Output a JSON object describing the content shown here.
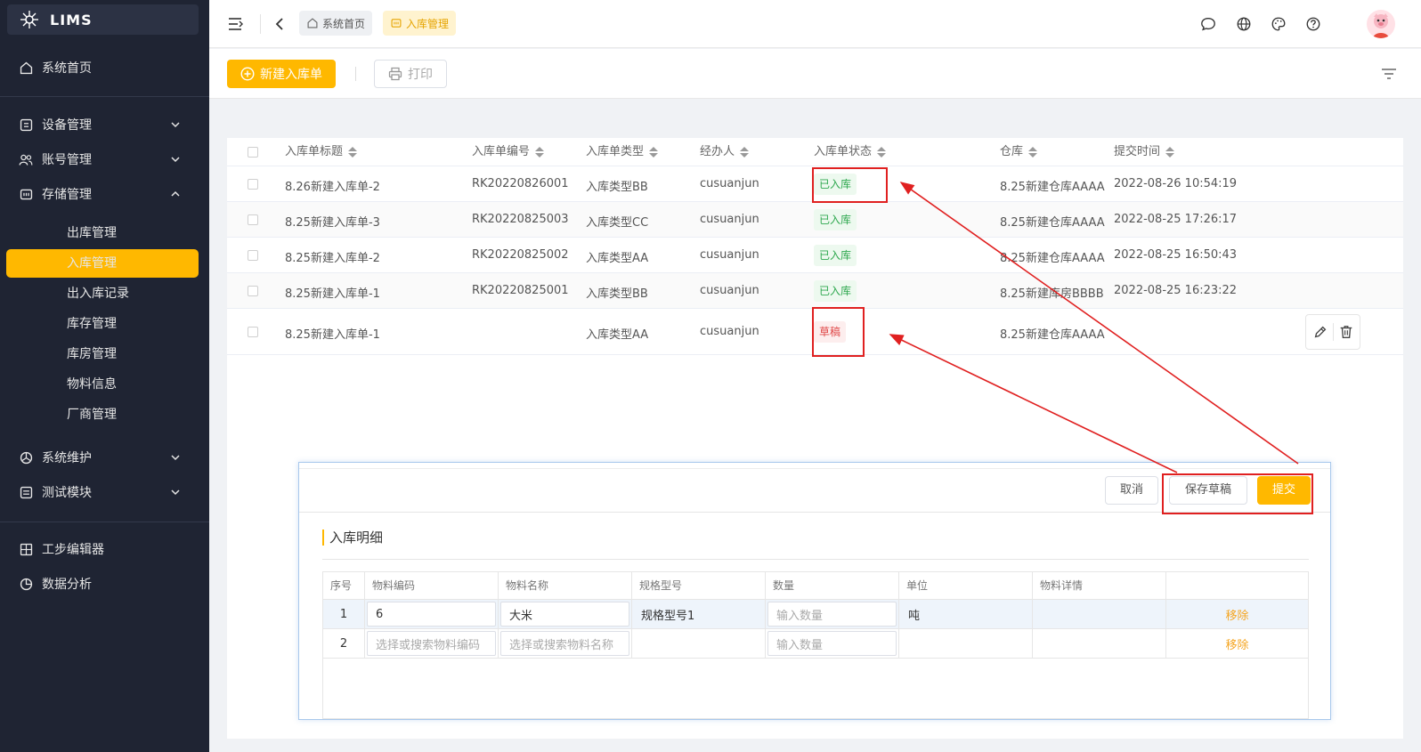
{
  "app": {
    "name": "LIMS"
  },
  "sidebar": {
    "items": [
      {
        "label": "系统首页",
        "icon": "home-icon"
      },
      {
        "label": "设备管理",
        "icon": "device-icon"
      },
      {
        "label": "账号管理",
        "icon": "users-icon"
      },
      {
        "label": "存储管理",
        "icon": "storage-icon"
      },
      {
        "label": "系统维护",
        "icon": "maintenance-icon"
      },
      {
        "label": "测试模块",
        "icon": "test-module-icon"
      },
      {
        "label": "工步编辑器",
        "icon": "grid-icon"
      },
      {
        "label": "数据分析",
        "icon": "pie-chart-icon"
      }
    ],
    "storage_sub": [
      "出库管理",
      "入库管理",
      "出入库记录",
      "库存管理",
      "库房管理",
      "物料信息",
      "厂商管理"
    ]
  },
  "header": {
    "breadcrumbs": [
      {
        "label": "系统首页"
      },
      {
        "label": "入库管理"
      }
    ]
  },
  "toolbar": {
    "new_label": "新建入库单",
    "print_label": "打印"
  },
  "table": {
    "columns": [
      "入库单标题",
      "入库单编号",
      "入库单类型",
      "经办人",
      "入库单状态",
      "仓库",
      "提交时间"
    ],
    "rows": [
      {
        "title": "8.26新建入库单-2",
        "code": "RK20220826001",
        "type": "入库类型BB",
        "handler": "cusuanjun",
        "status": "已入库",
        "warehouse": "8.25新建仓库AAAA",
        "time": "2022-08-26 10:54:19"
      },
      {
        "title": "8.25新建入库单-3",
        "code": "RK20220825003",
        "type": "入库类型CC",
        "handler": "cusuanjun",
        "status": "已入库",
        "warehouse": "8.25新建仓库AAAA",
        "time": "2022-08-25 17:26:17"
      },
      {
        "title": "8.25新建入库单-2",
        "code": "RK20220825002",
        "type": "入库类型AA",
        "handler": "cusuanjun",
        "status": "已入库",
        "warehouse": "8.25新建仓库AAAA",
        "time": "2022-08-25 16:50:43"
      },
      {
        "title": "8.25新建入库单-1",
        "code": "RK20220825001",
        "type": "入库类型BB",
        "handler": "cusuanjun",
        "status": "已入库",
        "warehouse": "8.25新建库房BBBB",
        "time": "2022-08-25 16:23:22"
      },
      {
        "title": "8.25新建入库单-1",
        "code": "",
        "type": "入库类型AA",
        "handler": "cusuanjun",
        "status": "草稿",
        "warehouse": "8.25新建仓库AAAA",
        "time": ""
      }
    ]
  },
  "modal": {
    "cancel_label": "取消",
    "save_draft_label": "保存草稿",
    "submit_label": "提交",
    "section_title": "入库明细",
    "columns": [
      "序号",
      "物料编码",
      "物料名称",
      "规格型号",
      "数量",
      "单位",
      "物料详情",
      ""
    ],
    "rows": [
      {
        "index": "1",
        "code_value": "6",
        "code_placeholder": "",
        "name_value": "大米",
        "name_placeholder": "",
        "spec": "规格型号1",
        "qty_placeholder": "输入数量",
        "unit": "吨",
        "detail": "",
        "action": "移除"
      },
      {
        "index": "2",
        "code_value": "",
        "code_placeholder": "选择或搜索物料编码",
        "name_value": "",
        "name_placeholder": "选择或搜索物料名称",
        "spec": "",
        "qty_placeholder": "输入数量",
        "unit": "",
        "detail": "",
        "action": "移除"
      }
    ]
  },
  "colors": {
    "accent": "#ffb800",
    "sidebar_bg": "#1f2433",
    "success": "#2fa84f",
    "danger": "#e04848",
    "annotation": "#e02020"
  }
}
